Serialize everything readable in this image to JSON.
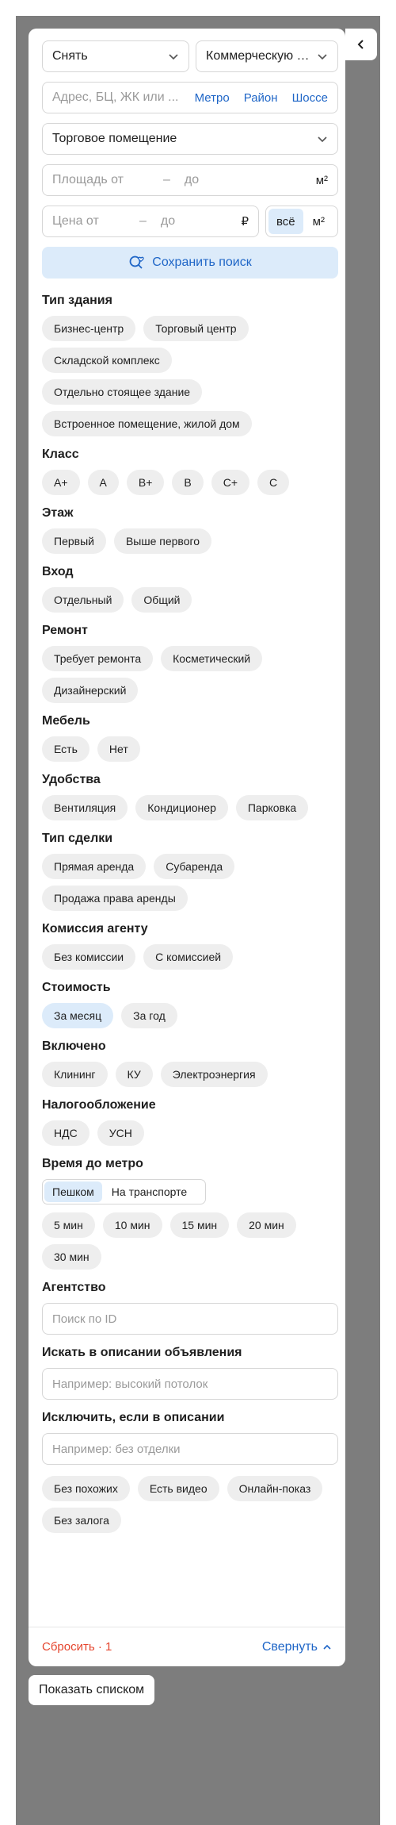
{
  "deal_select": "Снять",
  "type_select": "Коммерческую н...",
  "address": {
    "placeholder": "Адрес, БЦ, ЖК или ...",
    "links": [
      "Метро",
      "Район",
      "Шоссе"
    ]
  },
  "category_select": "Торговое помещение",
  "area": {
    "from_placeholder": "Площадь от",
    "sep": "–",
    "to_placeholder": "до",
    "unit": "м²"
  },
  "price": {
    "from_placeholder": "Цена от",
    "sep": "–",
    "to_placeholder": "до",
    "unit": "₽"
  },
  "price_mode": {
    "options": [
      "всё",
      "м²"
    ],
    "selected": "всё"
  },
  "save_search_label": "Сохранить поиск",
  "filters": {
    "building_type": {
      "title": "Тип здания",
      "chips": [
        "Бизнес-центр",
        "Торговый центр",
        "Складской комплекс",
        "Отдельно стоящее здание",
        "Встроенное помещение, жилой дом"
      ]
    },
    "class": {
      "title": "Класс",
      "chips": [
        "A+",
        "A",
        "B+",
        "B",
        "C+",
        "C"
      ]
    },
    "floor": {
      "title": "Этаж",
      "chips": [
        "Первый",
        "Выше первого"
      ]
    },
    "entrance": {
      "title": "Вход",
      "chips": [
        "Отдельный",
        "Общий"
      ]
    },
    "renovation": {
      "title": "Ремонт",
      "chips": [
        "Требует ремонта",
        "Косметический",
        "Дизайнерский"
      ]
    },
    "furniture": {
      "title": "Мебель",
      "chips": [
        "Есть",
        "Нет"
      ]
    },
    "amenities": {
      "title": "Удобства",
      "chips": [
        "Вентиляция",
        "Кондиционер",
        "Парковка"
      ]
    },
    "deal_type": {
      "title": "Тип сделки",
      "chips": [
        "Прямая аренда",
        "Субаренда",
        "Продажа права аренды"
      ]
    },
    "agent_fee": {
      "title": "Комиссия агенту",
      "chips": [
        "Без комиссии",
        "С комиссией"
      ]
    },
    "cost": {
      "title": "Стоимость",
      "chips": [
        "За месяц",
        "За год"
      ],
      "selected": "За месяц"
    },
    "included": {
      "title": "Включено",
      "chips": [
        "Клининг",
        "КУ",
        "Электроэнергия"
      ]
    },
    "taxation": {
      "title": "Налогообложение",
      "chips": [
        "НДС",
        "УСН"
      ]
    }
  },
  "metro_time": {
    "title": "Время до метро",
    "modes": [
      "Пешком",
      "На транспорте"
    ],
    "selected_mode": "Пешком",
    "chips": [
      "5 мин",
      "10 мин",
      "15 мин",
      "20 мин",
      "30 мин"
    ]
  },
  "agency": {
    "title": "Агентство",
    "placeholder": "Поиск по ID"
  },
  "search_desc": {
    "title": "Искать в описании объявления",
    "placeholder": "Например: высокий потолок"
  },
  "exclude_desc": {
    "title": "Исключить, если в описании",
    "placeholder": "Например: без отделки"
  },
  "extra_chips": [
    "Без похожих",
    "Есть видео",
    "Онлайн-показ",
    "Без залога"
  ],
  "footer": {
    "reset_label": "Сбросить · 1",
    "collapse_label": "Свернуть"
  },
  "show_list_label": "Показать списком",
  "colors": {
    "accent": "#1f66c7",
    "accent_bg": "#dcebfa",
    "reset": "#e5452d",
    "chip_bg": "#eeeeee",
    "backdrop": "#7d7d7d"
  }
}
